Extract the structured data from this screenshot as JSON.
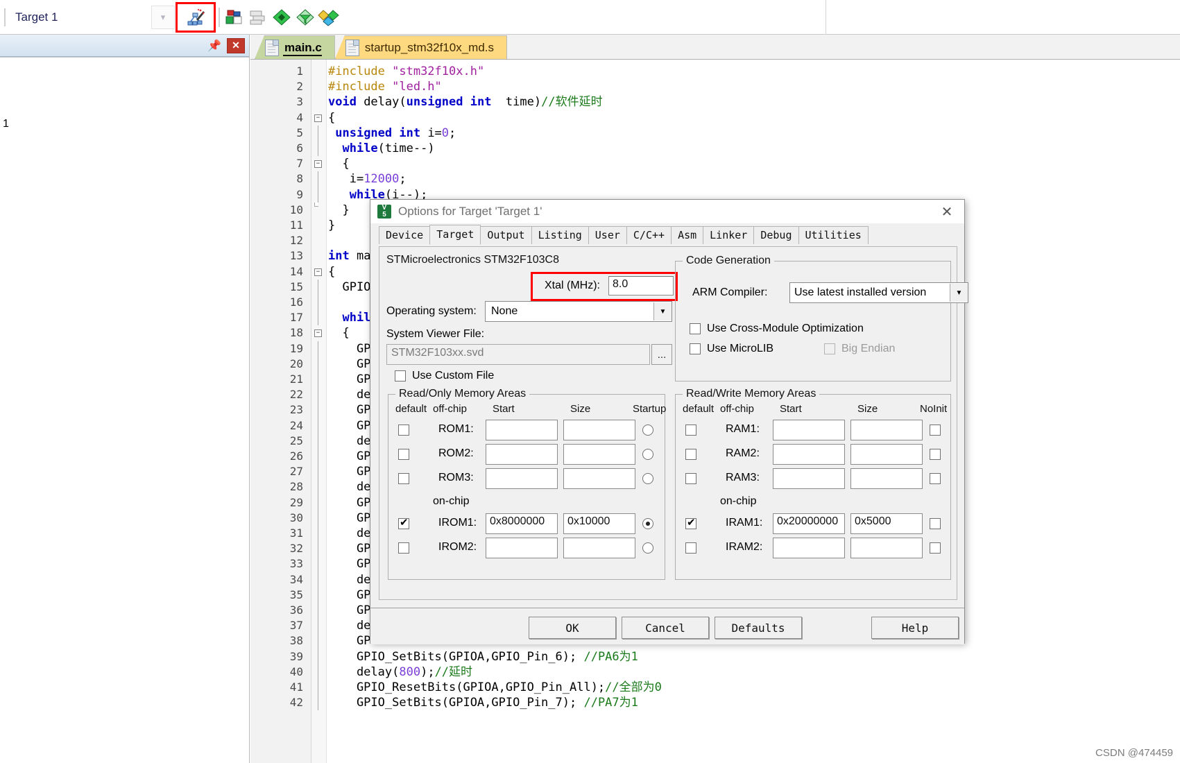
{
  "toolbar": {
    "target_name": "Target 1",
    "dropdown_icon": "chevron-down-icon",
    "manage_icon": "manage-project-items-icon",
    "icons": [
      "target-options-icon",
      "batch-build-icon",
      "green-diamond-icon",
      "filter-diamond-icon",
      "multi-diamond-icon"
    ]
  },
  "left_pane": {
    "pin_icon": "pin-icon",
    "close_icon": "close-icon",
    "root_label": "1"
  },
  "editor": {
    "tabs": [
      {
        "label": "main.c",
        "active": true,
        "icon": "file-icon"
      },
      {
        "label": "startup_stm32f10x_md.s",
        "active": false,
        "icon": "file-icon"
      }
    ],
    "lines": [
      {
        "n": 1,
        "fold": "",
        "tokens": [
          [
            "pp",
            "#include "
          ],
          [
            "str",
            "\"stm32f10x.h\""
          ]
        ]
      },
      {
        "n": 2,
        "fold": "",
        "tokens": [
          [
            "pp",
            "#include "
          ],
          [
            "str",
            "\"led.h\""
          ]
        ]
      },
      {
        "n": 3,
        "fold": "",
        "tokens": [
          [
            "kw",
            "void "
          ],
          [
            "pl",
            "delay("
          ],
          [
            "kw",
            "unsigned int"
          ],
          [
            "pl",
            "  time)"
          ],
          [
            "cm",
            "//软件延时"
          ]
        ]
      },
      {
        "n": 4,
        "fold": "open",
        "tokens": [
          [
            "pl",
            "{"
          ]
        ]
      },
      {
        "n": 5,
        "fold": "bar",
        "tokens": [
          [
            "pl",
            " "
          ],
          [
            "kw",
            "unsigned int"
          ],
          [
            "pl",
            " i="
          ],
          [
            "num",
            "0"
          ],
          [
            "pl",
            ";"
          ]
        ]
      },
      {
        "n": 6,
        "fold": "bar",
        "tokens": [
          [
            "pl",
            "  "
          ],
          [
            "kw",
            "while"
          ],
          [
            "pl",
            "(time--)"
          ]
        ]
      },
      {
        "n": 7,
        "fold": "open",
        "tokens": [
          [
            "pl",
            "  {"
          ]
        ]
      },
      {
        "n": 8,
        "fold": "bar",
        "tokens": [
          [
            "pl",
            "   i="
          ],
          [
            "num",
            "12000"
          ],
          [
            "pl",
            ";"
          ]
        ]
      },
      {
        "n": 9,
        "fold": "bar",
        "tokens": [
          [
            "pl",
            "   "
          ],
          [
            "kw",
            "while"
          ],
          [
            "pl",
            "(i--);"
          ]
        ]
      },
      {
        "n": 10,
        "fold": "end",
        "tokens": [
          [
            "pl",
            "  }"
          ]
        ]
      },
      {
        "n": 11,
        "fold": "",
        "tokens": [
          [
            "pl",
            "}"
          ]
        ]
      },
      {
        "n": 12,
        "fold": "",
        "tokens": [
          [
            "pl",
            ""
          ]
        ]
      },
      {
        "n": 13,
        "fold": "",
        "tokens": [
          [
            "kw",
            "int "
          ],
          [
            "pl",
            "mai"
          ]
        ]
      },
      {
        "n": 14,
        "fold": "open",
        "tokens": [
          [
            "pl",
            "{"
          ]
        ]
      },
      {
        "n": 15,
        "fold": "bar",
        "tokens": [
          [
            "pl",
            "  GPIOA"
          ]
        ]
      },
      {
        "n": 16,
        "fold": "bar",
        "tokens": [
          [
            "pl",
            ""
          ]
        ]
      },
      {
        "n": 17,
        "fold": "bar",
        "tokens": [
          [
            "kw",
            "  while"
          ]
        ]
      },
      {
        "n": 18,
        "fold": "open",
        "tokens": [
          [
            "pl",
            "  {"
          ]
        ]
      },
      {
        "n": 19,
        "fold": "bar",
        "tokens": [
          [
            "pl",
            "    GPI"
          ]
        ]
      },
      {
        "n": 20,
        "fold": "bar",
        "tokens": [
          [
            "pl",
            "    GPI"
          ]
        ]
      },
      {
        "n": 21,
        "fold": "bar",
        "tokens": [
          [
            "pl",
            "    GPI"
          ]
        ]
      },
      {
        "n": 22,
        "fold": "bar",
        "tokens": [
          [
            "pl",
            "    del"
          ]
        ]
      },
      {
        "n": 23,
        "fold": "bar",
        "tokens": [
          [
            "pl",
            "    GPI"
          ]
        ]
      },
      {
        "n": 24,
        "fold": "bar",
        "tokens": [
          [
            "pl",
            "    GPI"
          ]
        ]
      },
      {
        "n": 25,
        "fold": "bar",
        "tokens": [
          [
            "pl",
            "    del"
          ]
        ]
      },
      {
        "n": 26,
        "fold": "bar",
        "tokens": [
          [
            "pl",
            "    GPI"
          ]
        ]
      },
      {
        "n": 27,
        "fold": "bar",
        "tokens": [
          [
            "pl",
            "    GPI"
          ]
        ]
      },
      {
        "n": 28,
        "fold": "bar",
        "tokens": [
          [
            "pl",
            "    del"
          ]
        ]
      },
      {
        "n": 29,
        "fold": "bar",
        "tokens": [
          [
            "pl",
            "    GPI"
          ]
        ]
      },
      {
        "n": 30,
        "fold": "bar",
        "tokens": [
          [
            "pl",
            "    GPI"
          ]
        ]
      },
      {
        "n": 31,
        "fold": "bar",
        "tokens": [
          [
            "pl",
            "    del"
          ]
        ]
      },
      {
        "n": 32,
        "fold": "bar",
        "tokens": [
          [
            "pl",
            "    GPI"
          ]
        ]
      },
      {
        "n": 33,
        "fold": "bar",
        "tokens": [
          [
            "pl",
            "    GPI"
          ]
        ]
      },
      {
        "n": 34,
        "fold": "bar",
        "tokens": [
          [
            "pl",
            "    del"
          ]
        ]
      },
      {
        "n": 35,
        "fold": "bar",
        "tokens": [
          [
            "pl",
            "    GPI"
          ]
        ]
      },
      {
        "n": 36,
        "fold": "bar",
        "tokens": [
          [
            "pl",
            "    GPI"
          ]
        ]
      },
      {
        "n": 37,
        "fold": "bar",
        "tokens": [
          [
            "pl",
            "    del"
          ]
        ]
      },
      {
        "n": 38,
        "fold": "bar",
        "tokens": [
          [
            "pl",
            "    GPI"
          ]
        ]
      },
      {
        "n": 39,
        "fold": "bar",
        "tokens": [
          [
            "pl",
            "    GPIO_SetBits(GPIOA,GPIO_Pin_6); "
          ],
          [
            "cm",
            "//PA6为1"
          ]
        ]
      },
      {
        "n": 40,
        "fold": "bar",
        "tokens": [
          [
            "pl",
            "    delay("
          ],
          [
            "num",
            "800"
          ],
          [
            "pl",
            ");"
          ],
          [
            "cm",
            "//延时"
          ]
        ]
      },
      {
        "n": 41,
        "fold": "bar",
        "tokens": [
          [
            "pl",
            "    GPIO_ResetBits(GPIOA,GPIO_Pin_All);"
          ],
          [
            "cm",
            "//全部为0"
          ]
        ]
      },
      {
        "n": 42,
        "fold": "bar",
        "tokens": [
          [
            "pl",
            "    GPIO_SetBits(GPIOA,GPIO_Pin_7); "
          ],
          [
            "cm",
            "//PA7为1"
          ]
        ]
      }
    ]
  },
  "dialog": {
    "title": "Options for Target 'Target 1'",
    "app_icon": "keil-uvision-icon",
    "close_icon": "close-icon",
    "tabs": [
      {
        "label": "Device",
        "selected": false
      },
      {
        "label": "Target",
        "selected": true
      },
      {
        "label": "Output",
        "selected": false
      },
      {
        "label": "Listing",
        "selected": false
      },
      {
        "label": "User",
        "selected": false
      },
      {
        "label": "C/C++",
        "selected": false
      },
      {
        "label": "Asm",
        "selected": false
      },
      {
        "label": "Linker",
        "selected": false
      },
      {
        "label": "Debug",
        "selected": false
      },
      {
        "label": "Utilities",
        "selected": false
      }
    ],
    "device_title": "STMicroelectronics STM32F103C8",
    "xtal": {
      "label": "Xtal (MHz):",
      "value": "8.0",
      "highlight_color": "#ff0000"
    },
    "operating_system": {
      "label": "Operating system:",
      "value": "None",
      "arrow_icon": "chevron-down-icon"
    },
    "system_viewer_file": {
      "label": "System Viewer File:",
      "value": "STM32F103xx.svd",
      "browse_label": "..."
    },
    "use_custom_file": {
      "label": "Use Custom File",
      "checked": false
    },
    "code_generation": {
      "legend": "Code Generation",
      "arm_compiler": {
        "label": "ARM Compiler:",
        "value": "Use latest installed version",
        "arrow_icon": "chevron-down-icon"
      },
      "cross_module": {
        "label": "Use Cross-Module Optimization",
        "checked": false
      },
      "microlib": {
        "label": "Use MicroLIB",
        "checked": false
      },
      "big_endian": {
        "label": "Big Endian",
        "checked": false,
        "disabled": true
      }
    },
    "rom_group": {
      "legend": "Read/Only Memory Areas",
      "columns": [
        "default",
        "off-chip",
        "Start",
        "Size",
        "Startup"
      ],
      "onchip_label": "on-chip",
      "rows": [
        {
          "name": "ROM1:",
          "default": false,
          "start": "",
          "size": "",
          "startup": false,
          "section": "off-chip"
        },
        {
          "name": "ROM2:",
          "default": false,
          "start": "",
          "size": "",
          "startup": false,
          "section": "off-chip"
        },
        {
          "name": "ROM3:",
          "default": false,
          "start": "",
          "size": "",
          "startup": false,
          "section": "off-chip"
        },
        {
          "name": "IROM1:",
          "default": true,
          "start": "0x8000000",
          "size": "0x10000",
          "startup": true,
          "section": "on-chip"
        },
        {
          "name": "IROM2:",
          "default": false,
          "start": "",
          "size": "",
          "startup": false,
          "section": "on-chip"
        }
      ]
    },
    "ram_group": {
      "legend": "Read/Write Memory Areas",
      "columns": [
        "default",
        "off-chip",
        "Start",
        "Size",
        "NoInit"
      ],
      "onchip_label": "on-chip",
      "rows": [
        {
          "name": "RAM1:",
          "default": false,
          "start": "",
          "size": "",
          "noinit": false,
          "section": "off-chip"
        },
        {
          "name": "RAM2:",
          "default": false,
          "start": "",
          "size": "",
          "noinit": false,
          "section": "off-chip"
        },
        {
          "name": "RAM3:",
          "default": false,
          "start": "",
          "size": "",
          "noinit": false,
          "section": "off-chip"
        },
        {
          "name": "IRAM1:",
          "default": true,
          "start": "0x20000000",
          "size": "0x5000",
          "noinit": false,
          "section": "on-chip"
        },
        {
          "name": "IRAM2:",
          "default": false,
          "start": "",
          "size": "",
          "noinit": false,
          "section": "on-chip"
        }
      ]
    },
    "buttons": [
      {
        "label": "OK"
      },
      {
        "label": "Cancel"
      },
      {
        "label": "Defaults"
      },
      {
        "label": "Help"
      }
    ]
  },
  "watermark": "CSDN @474459"
}
